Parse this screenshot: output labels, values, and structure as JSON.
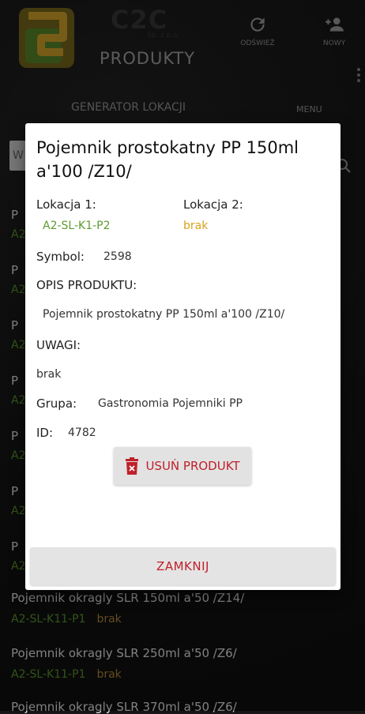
{
  "header": {
    "brand": "C2C",
    "brand_sub": "Sp. z o.o.",
    "title": "PRODUKTY",
    "refresh_label": "ODŚWIEŻ",
    "new_label": "NOWY"
  },
  "tabs": {
    "generator": "GENERATOR LOKACJI",
    "menu": "MENU"
  },
  "search": {
    "value": "W"
  },
  "list_stubs": [
    {
      "name": "P",
      "loc": "A2"
    },
    {
      "name": "P",
      "loc": "A2"
    },
    {
      "name": "P",
      "loc": "A2"
    },
    {
      "name": "P",
      "loc": "A2"
    },
    {
      "name": "P",
      "loc": "A2"
    },
    {
      "name": "P",
      "loc": "A2"
    },
    {
      "name": "P",
      "loc": "A2"
    }
  ],
  "list": [
    {
      "name": "Pojemnik okragly SLR 150ml a'50 /Z14/",
      "loc1": "A2-SL-K11-P1",
      "loc2": "brak"
    },
    {
      "name": "Pojemnik okragly SLR 250ml a'50 /Z6/",
      "loc1": "A2-SL-K11-P1",
      "loc2": "brak"
    },
    {
      "name": "Pojemnik okragly SLR 370ml a'50 /Z6/",
      "loc1": "",
      "loc2": ""
    }
  ],
  "dialog": {
    "title": "Pojemnik prostokatny PP 150ml a'100 /Z10/",
    "loc1_label": "Lokacja 1:",
    "loc1_value": "A2-SL-K1-P2",
    "loc2_label": "Lokacja 2:",
    "loc2_value": "brak",
    "symbol_label": "Symbol:",
    "symbol_value": "2598",
    "desc_label": "OPIS PRODUKTU:",
    "desc_value": "Pojemnik prostokatny PP 150ml a'100 /Z10/",
    "notes_label": "UWAGI:",
    "notes_value": "brak",
    "group_label": "Grupa:",
    "group_value": "Gastronomia Pojemniki PP",
    "id_label": "ID:",
    "id_value": "4782",
    "delete_label": "USUŃ PRODUKT",
    "close_label": "ZAMKNIJ"
  },
  "colors": {
    "location": "#5d9a2f",
    "missing": "#d8a31c",
    "danger": "#c0202a"
  }
}
